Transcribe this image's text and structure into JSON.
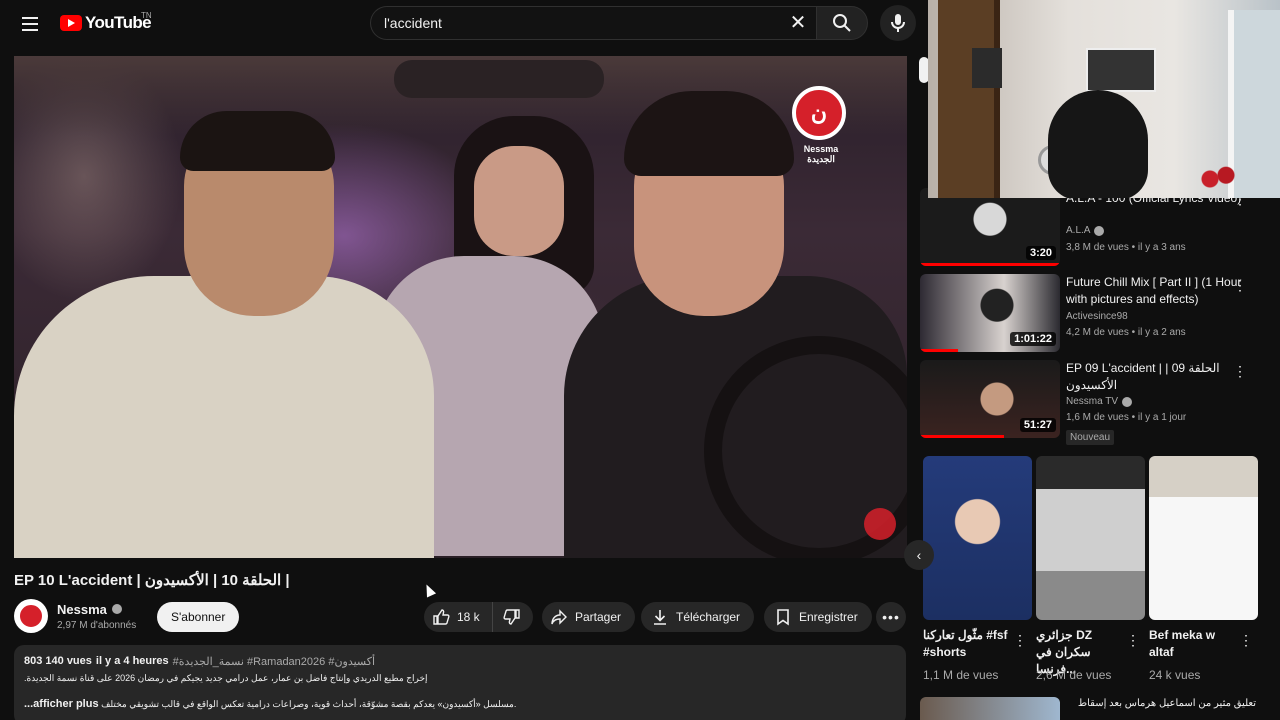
{
  "header": {
    "logo_text": "YouTube",
    "logo_country": "TN",
    "search_value": "l'accident"
  },
  "video": {
    "title": "EP 10 L'accident | الحلقة 10 | الأكسيدون |",
    "channel_name": "Nessma",
    "channel_subs": "2,97 M d'abonnés",
    "subscribe_label": "S'abonner",
    "likes": "18 k",
    "share_label": "Partager",
    "download_label": "Télécharger",
    "save_label": "Enregistrer",
    "channel_logo_text": "Nessma الجديدة"
  },
  "description": {
    "views": "803 140 vues",
    "age": "il y a 4 heures",
    "tags": "#نسمة_الجديدة #Ramadan2026 #أكسيدون",
    "line2": "إخراج مطيع الدريدي وإنتاج فاضل بن عمار، عمل درامي جديد يجيكم في رمضان 2026 على قناة نسمة الجديدة.",
    "line3": "مسلسل «أكسيدون» يعدكم بقصة مشوّقة، أحداث قوية، وصراعات درامية تعكس الواقع في قالب تشويقي مختلف.",
    "more_label": "...afficher plus"
  },
  "recommendations": [
    {
      "title": "A.L.A - 100 (Official Lyrics Video)",
      "channel": "A.L.A",
      "meta": "3,8 M de vues • il y a 3 ans",
      "duration": "3:20",
      "progress": 1.0
    },
    {
      "title": "Future Chill Mix [ Part II ] (1 Hour with pictures and effects)",
      "channel": "Activesince98",
      "meta": "4,2 M de vues • il y a 2 ans",
      "duration": "1:01:22",
      "progress": 0.27
    },
    {
      "title": "EP 09 L'accident | الحلقة 09 | الأكسيدون",
      "channel": "Nessma TV",
      "meta": "1,6 M de vues • il y a 1 jour",
      "duration": "51:27",
      "progress": 0.6,
      "badge": "Nouveau"
    }
  ],
  "shorts": [
    {
      "title": "مثّول تعاركنا #fsf #shorts",
      "views": "1,1 M de vues"
    },
    {
      "title": "جزائري DZ سكران في فرنسا...",
      "views": "2,6 M de vues"
    },
    {
      "title": "Bef meka w altaf",
      "views": "24 k vues"
    }
  ],
  "next_rec_title": "تعليق مثير من اسماعيل هرماس بعد إسقاط"
}
